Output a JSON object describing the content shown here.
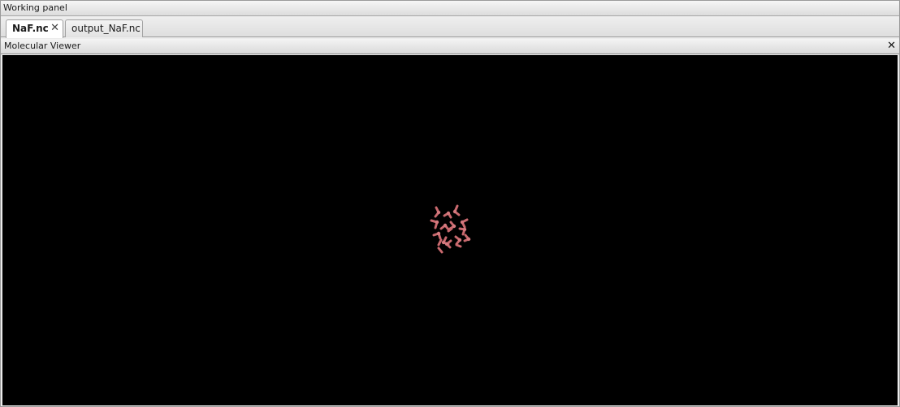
{
  "panel": {
    "title": "Working panel"
  },
  "tabs": [
    {
      "label": "NaF.nc",
      "active": true,
      "closable": true,
      "close_icon": "close-icon"
    },
    {
      "label": "output_NaF.nc",
      "active": false,
      "closable": false
    }
  ],
  "viewer": {
    "title": "Molecular Viewer",
    "close_icon": "close-icon",
    "background": "#000000",
    "molecule_color": "#c9696e"
  }
}
